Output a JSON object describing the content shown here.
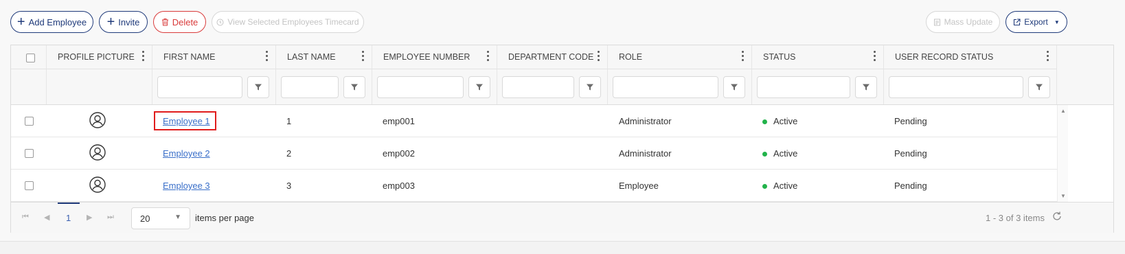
{
  "toolbar": {
    "add_employee": "Add Employee",
    "invite": "Invite",
    "delete": "Delete",
    "view_timecard": "View Selected Employees Timecard",
    "mass_update": "Mass Update",
    "export": "Export"
  },
  "columns": [
    "PROFILE PICTURE",
    "FIRST NAME",
    "LAST NAME",
    "EMPLOYEE NUMBER",
    "DEPARTMENT CODE",
    "ROLE",
    "STATUS",
    "USER RECORD STATUS"
  ],
  "rows": [
    {
      "first_name": "Employee 1",
      "last_name": "1",
      "employee_number": "emp001",
      "department_code": "",
      "role": "Administrator",
      "status": "Active",
      "user_record_status": "Pending"
    },
    {
      "first_name": "Employee 2",
      "last_name": "2",
      "employee_number": "emp002",
      "department_code": "",
      "role": "Administrator",
      "status": "Active",
      "user_record_status": "Pending"
    },
    {
      "first_name": "Employee 3",
      "last_name": "3",
      "employee_number": "emp003",
      "department_code": "",
      "role": "Employee",
      "status": "Active",
      "user_record_status": "Pending"
    }
  ],
  "pager": {
    "page": "1",
    "page_size": "20",
    "items_per_page_label": "items per page",
    "info": "1 - 3 of 3 items"
  },
  "colors": {
    "primary": "#1f3a7a",
    "danger": "#d93a3a",
    "link": "#3a6fc9",
    "active": "#22b34b",
    "highlight": "#e01b1b"
  }
}
